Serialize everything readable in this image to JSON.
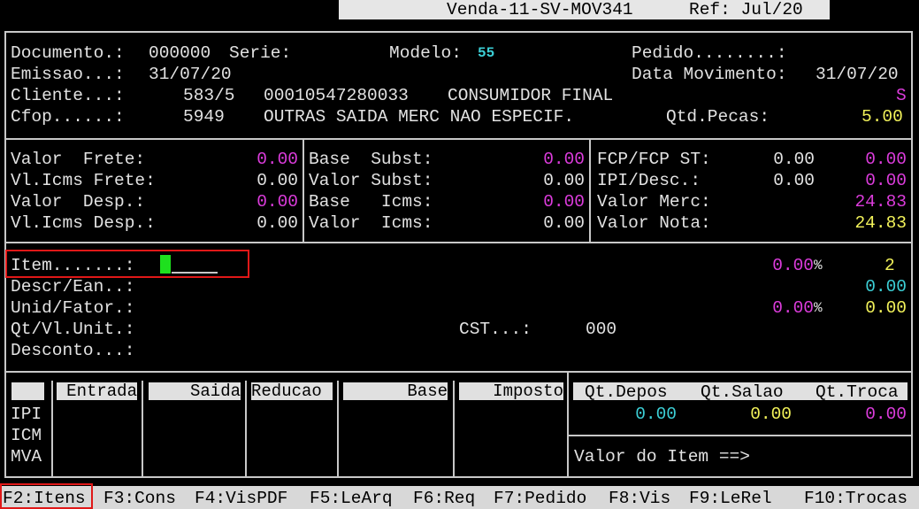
{
  "title": {
    "program": "Venda-11-SV-MOV341",
    "ref": "Ref: Jul/20"
  },
  "doc": {
    "documento_label": "Documento.:",
    "documento": "000000",
    "serie_label": "Serie:",
    "modelo_label": "Modelo:",
    "modelo": "55",
    "pedido_label": "Pedido........:",
    "emissao_label": "Emissao...:",
    "emissao": "31/07/20",
    "data_mov_label": "Data Movimento:",
    "data_mov": "31/07/20",
    "cliente_label": "Cliente...:",
    "cliente_cod": "583/5",
    "cliente_doc": "00010547280033",
    "cliente_nome": "CONSUMIDOR FINAL",
    "flag": "S",
    "cfop_label": "Cfop......:",
    "cfop": "5949",
    "cfop_desc": "OUTRAS SAIDA MERC NAO ESPECIF.",
    "qtd_pecas_label": "Qtd.Pecas:",
    "qtd_pecas": "5.00"
  },
  "totals": {
    "valor_frete_label": "Valor  Frete:",
    "valor_frete": "0.00",
    "vlicms_frete_label": "Vl.Icms Frete:",
    "vlicms_frete": "0.00",
    "valor_desp_label": "Valor  Desp.:",
    "valor_desp": "0.00",
    "vlicms_desp_label": "Vl.Icms Desp.:",
    "vlicms_desp": "0.00",
    "base_subst_label": "Base  Subst:",
    "base_subst": "0.00",
    "valor_subst_label": "Valor Subst:",
    "valor_subst": "0.00",
    "base_icms_label": "Base   Icms:",
    "base_icms": "0.00",
    "valor_icms_label": "Valor  Icms:",
    "valor_icms": "0.00",
    "fcp_label": "FCP/FCP ST:",
    "fcp_a": "0.00",
    "fcp_b": "0.00",
    "ipi_desc_label": "IPI/Desc.:",
    "ipi_desc_a": "0.00",
    "ipi_desc_b": "0.00",
    "valor_merc_label": "Valor Merc:",
    "valor_merc": "24.83",
    "valor_nota_label": "Valor Nota:",
    "valor_nota": "24.83"
  },
  "item": {
    "item_label": "Item.......:",
    "pct1": "0.00",
    "pct_sign1": "%",
    "count": "2",
    "descr_label": "Descr/Ean..:",
    "val_c": "0.00",
    "unid_label": "Unid/Fator.:",
    "pct2": "0.00",
    "pct_sign2": "%",
    "val_y": "0.00",
    "qt_label": "Qt/Vl.Unit.:",
    "cst_label": "CST...:",
    "cst": "000",
    "desconto_label": "Desconto...:"
  },
  "taxes": {
    "headers": [
      "Entrada",
      "Saida",
      "Reducao",
      "Base",
      "Imposto"
    ],
    "rows": [
      "IPI",
      "ICM",
      "MVA"
    ],
    "qt_headers": [
      "Qt.Depos",
      "Qt.Salao",
      "Qt.Troca"
    ],
    "qt_values": [
      "0.00",
      "0.00",
      "0.00"
    ],
    "valor_item_label": "Valor do Item ==>"
  },
  "fkeys": [
    "F2:Itens",
    "F3:Cons",
    "F4:VisPDF",
    "F5:LeArq",
    "F6:Req",
    "F7:Pedido",
    "F8:Vis",
    "F9:LeRel",
    "F10:Trocas"
  ],
  "colors": {
    "magenta": "#dc3cdc",
    "yellow": "#f2f25a",
    "cyan": "#3ccfd6",
    "highlight": "#e01818",
    "cursor": "#1ee01e"
  }
}
